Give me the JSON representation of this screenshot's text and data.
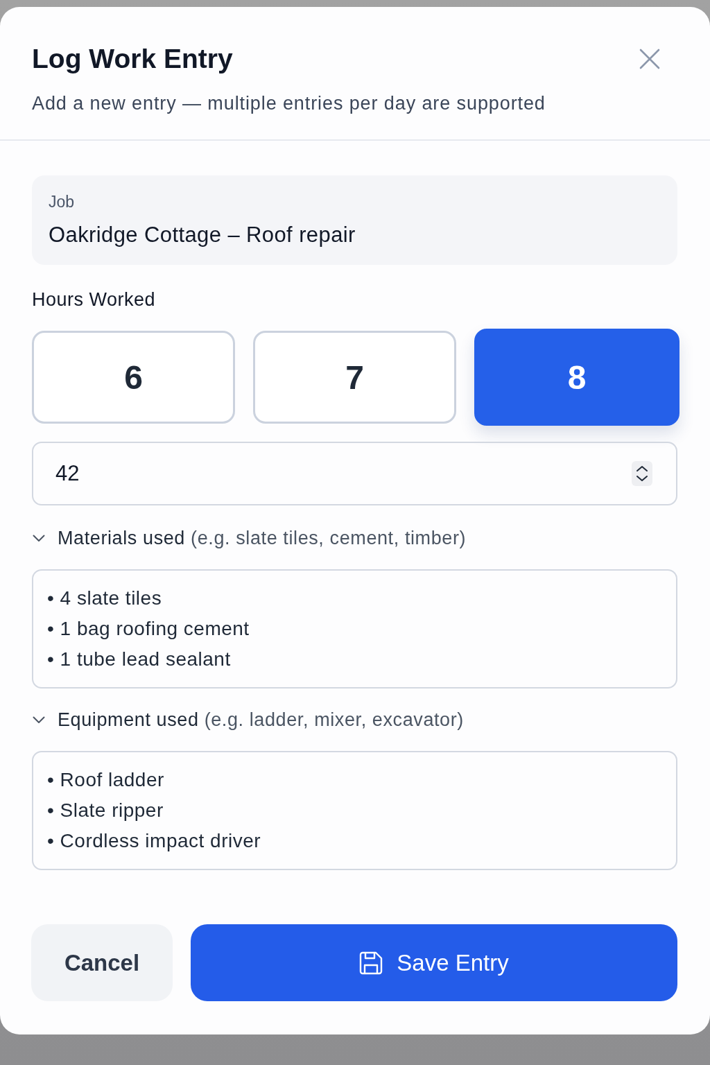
{
  "dialog": {
    "title": "Log Work Entry",
    "subtitle": "Add a new entry — multiple entries per day are supported"
  },
  "job": {
    "label": "Job",
    "value": "Oakridge Cottage – Roof repair"
  },
  "hours": {
    "label": "Hours Worked",
    "options": [
      {
        "label": "6",
        "selected": false
      },
      {
        "label": "7",
        "selected": false
      },
      {
        "label": "8",
        "selected": true
      }
    ],
    "custom": {
      "value": "42"
    }
  },
  "sections": [
    {
      "title": "Materials used",
      "hint": "(e.g. slate tiles, cement, timber)",
      "expanded": true,
      "items": [
        "• 4 slate tiles",
        "• 1 bag roofing cement",
        "• 1 tube lead sealant"
      ]
    },
    {
      "title": "Equipment used",
      "hint": "(e.g. ladder, mixer, excavator)",
      "expanded": true,
      "items": [
        "• Roof ladder",
        "• Slate ripper",
        "• Cordless impact driver"
      ]
    }
  ],
  "buttons": [
    {
      "kind": "secondary",
      "label": "Cancel"
    },
    {
      "kind": "primary",
      "label": "Save Entry"
    }
  ]
}
